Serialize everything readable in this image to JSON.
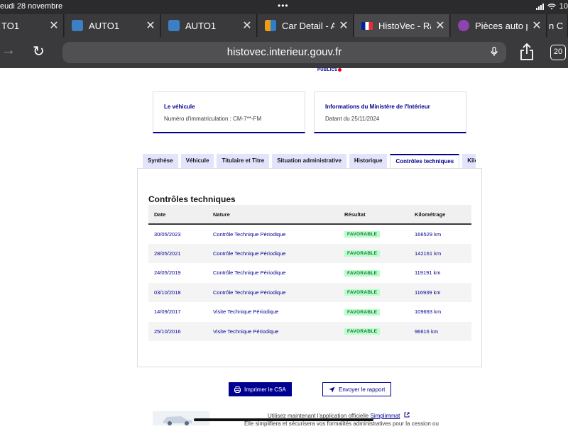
{
  "status_bar": {
    "time": "eudi 28 novembre",
    "dots": "•••",
    "battery": "10"
  },
  "browser_tabs": [
    {
      "label": "TO1",
      "favicon": "auto1-icon",
      "active": false
    },
    {
      "label": "AUTO1",
      "favicon": "auto1-icon",
      "active": false
    },
    {
      "label": "AUTO1",
      "favicon": "auto1-icon",
      "active": false
    },
    {
      "label": "Car Detail - Adi",
      "favicon": "car-detail-icon",
      "active": false
    },
    {
      "label": "HistoVec - Rapp",
      "favicon": "french-flag-icon",
      "active": true
    },
    {
      "label": "Pièces auto pas",
      "favicon": "parts-icon",
      "active": false
    }
  ],
  "tab_overflow": "n C",
  "tab_close_glyph": "✕",
  "address_bar": {
    "url": "histovec.interieur.gouv.fr",
    "tab_count": "20"
  },
  "logo_text": "PUBLICS",
  "vehicle_card": {
    "title": "Le véhicule",
    "text": "Numéro d'immatriculation : CM-7**-FM"
  },
  "ministry_card": {
    "title": "Informations du Ministère de l'Intérieur",
    "text": "Datant du 25/11/2024"
  },
  "page_tabs": [
    {
      "label": "Synthèse",
      "active": false
    },
    {
      "label": "Véhicule",
      "active": false
    },
    {
      "label": "Titulaire et Titre",
      "active": false
    },
    {
      "label": "Situation administrative",
      "active": false
    },
    {
      "label": "Historique",
      "active": false
    },
    {
      "label": "Contrôles techniques",
      "active": true
    },
    {
      "label": "Kilométrage",
      "active": false
    }
  ],
  "controles": {
    "title": "Contrôles techniques",
    "headers": [
      "Date",
      "Nature",
      "Résultat",
      "Kilométrage"
    ],
    "rows": [
      {
        "date": "30/05/2023",
        "nature": "Contrôle Technique Périodique",
        "resultat": "FAVORABLE",
        "km": "166529 km"
      },
      {
        "date": "28/05/2021",
        "nature": "Contrôle Technique Périodique",
        "resultat": "FAVORABLE",
        "km": "142161 km"
      },
      {
        "date": "24/05/2019",
        "nature": "Contrôle Technique Périodique",
        "resultat": "FAVORABLE",
        "km": "119191 km"
      },
      {
        "date": "03/10/2018",
        "nature": "Contrôle Technique Périodique",
        "resultat": "FAVORABLE",
        "km": "116939 km"
      },
      {
        "date": "14/09/2017",
        "nature": "Visite Technique Périodique",
        "resultat": "FAVORABLE",
        "km": "109693 km"
      },
      {
        "date": "25/10/2016",
        "nature": "Visite Technique Périodique",
        "resultat": "FAVORABLE",
        "km": "96616 km"
      }
    ]
  },
  "buttons": {
    "print": "Imprimer le CSA",
    "send": "Envoyer le rapport"
  },
  "promo": {
    "line1_prefix": "Utilisez maintenant l'application officielle ",
    "line1_link": "Simplimmat",
    "line2": "Elle simplifiera et sécurisera vos formalités administratives pour la cession ou"
  },
  "colors": {
    "brand_blue": "#000091",
    "success_bg": "#b8fec9",
    "success_text": "#18753c",
    "tab_bg": "#e3e3fd"
  }
}
